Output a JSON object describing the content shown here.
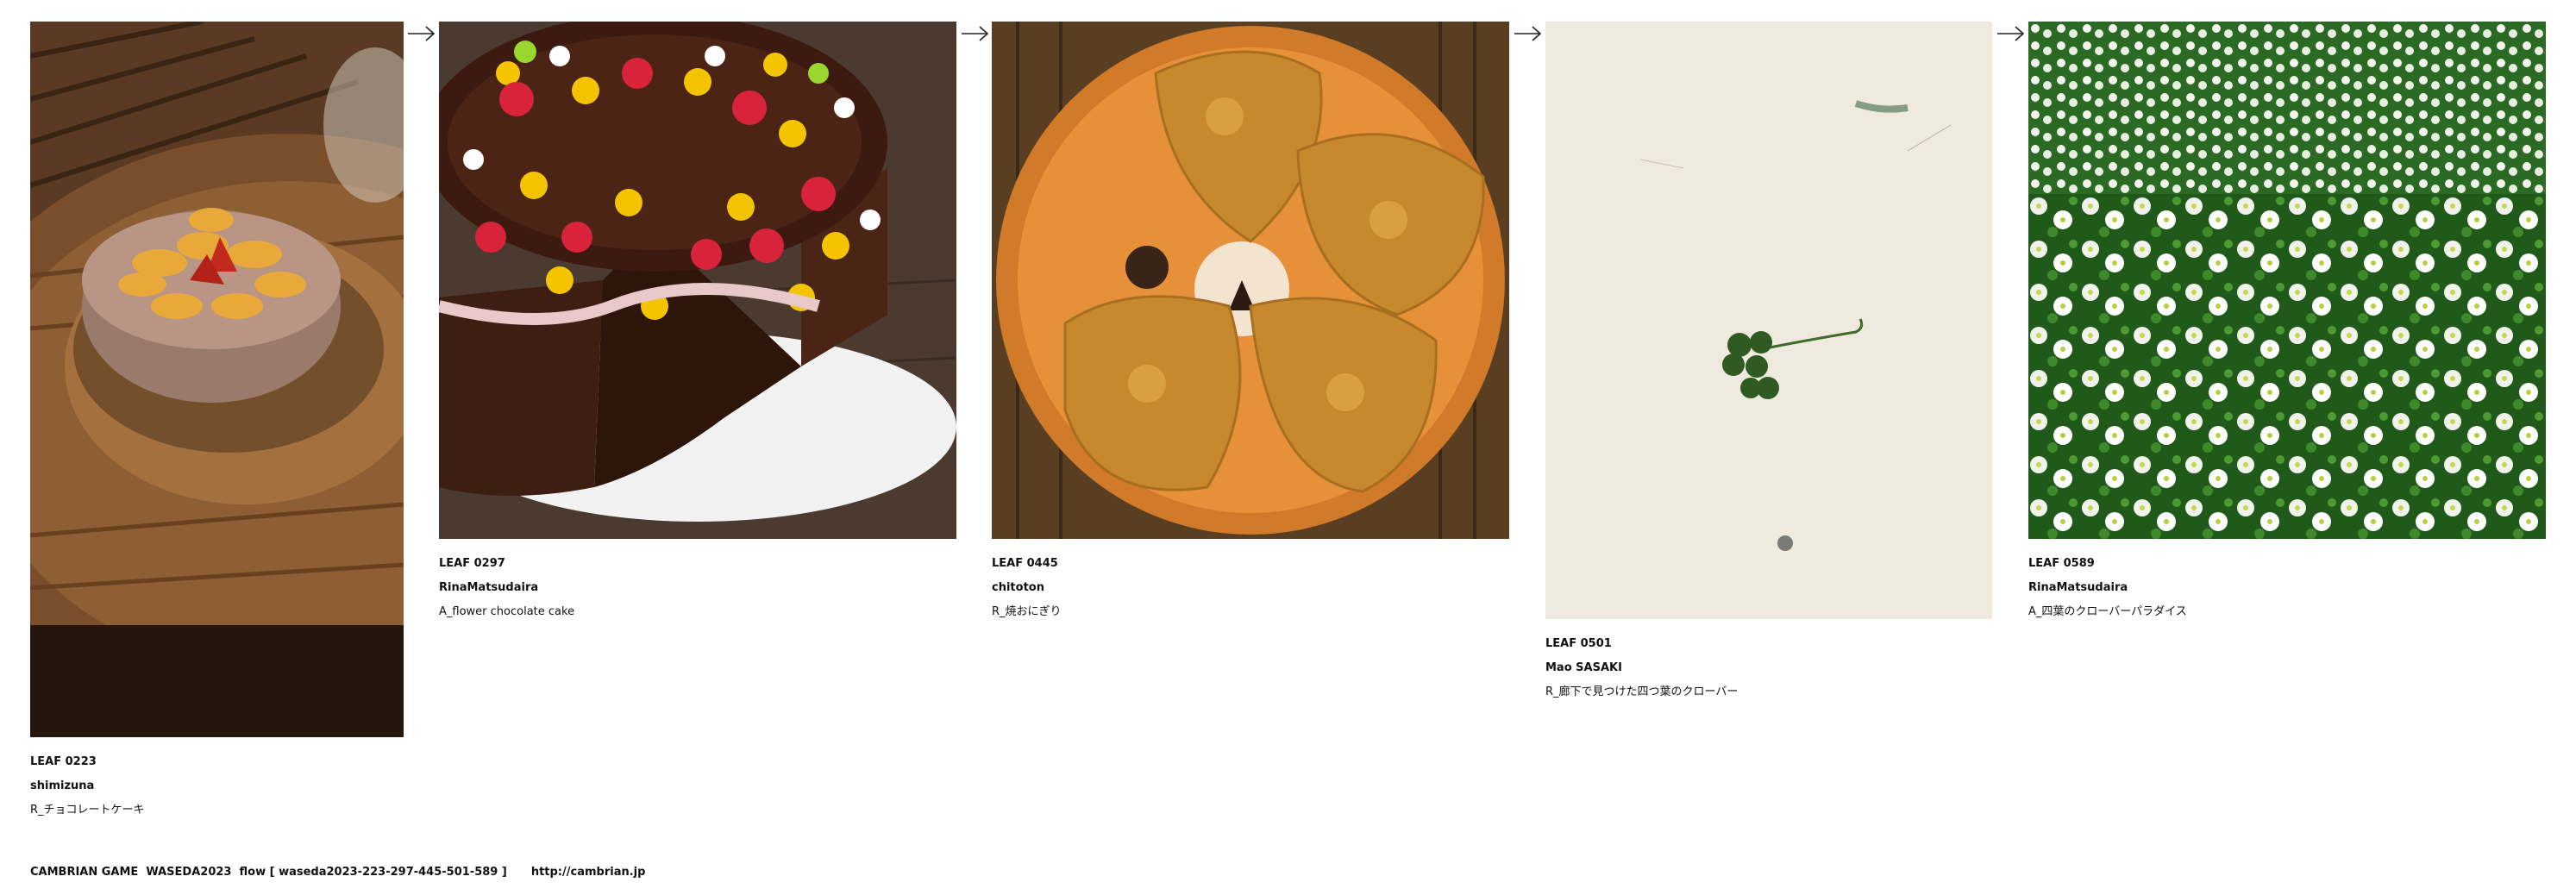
{
  "leaves": [
    {
      "id": "LEAF 0223",
      "author": "shimizuna",
      "title": "R_チョコレートケーキ",
      "image": "chocolate-cake-photo"
    },
    {
      "id": "LEAF 0297",
      "author": "RinaMatsudaira",
      "title": "A_flower chocolate cake",
      "image": "flower-chocolate-cake-illustration"
    },
    {
      "id": "LEAF 0445",
      "author": "chitoton",
      "title": "R_焼おにぎり",
      "image": "grilled-rice-balls-photo"
    },
    {
      "id": "LEAF 0501",
      "author": "Mao SASAKI",
      "title": "R_廊下で見つけた四つ葉のクローバー",
      "image": "four-leaf-clover-photo"
    },
    {
      "id": "LEAF 0589",
      "author": "RinaMatsudaira",
      "title": "A_四葉のクローバーパラダイス",
      "image": "clover-field-illustration"
    }
  ],
  "arrow_icon": "right-arrow-icon",
  "footer": {
    "text": "CAMBRIAN GAME  WASEDA2023  flow [ waseda2023-223-297-445-501-589 ]",
    "url": "http://cambrian.jp"
  }
}
